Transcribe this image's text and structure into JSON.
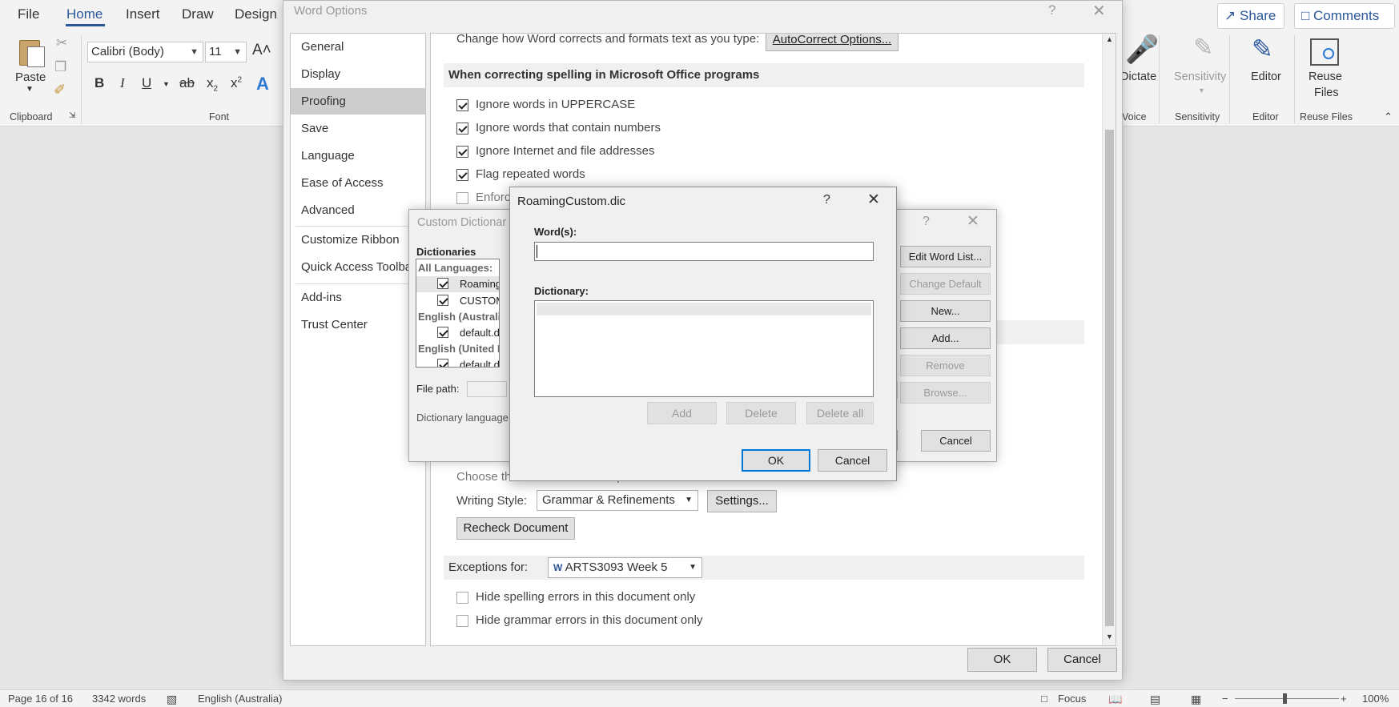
{
  "ribbon": {
    "tabs": [
      "File",
      "Home",
      "Insert",
      "Draw",
      "Design"
    ],
    "share_label": "Share",
    "comments_label": "Comments",
    "paste_label": "Paste",
    "font_name": "Calibri (Body)",
    "font_size": "11",
    "groups": {
      "clipboard": "Clipboard",
      "font": "Font",
      "voice": "Voice",
      "sensitivity": "Sensitivity",
      "editor": "Editor",
      "reuse_files": "Reuse Files"
    },
    "dictate_label": "Dictate",
    "sensitivity_label": "Sensitivity",
    "editor_label": "Editor",
    "reuse_files_label_1": "Reuse",
    "reuse_files_label_2": "Files"
  },
  "status_bar": {
    "page": "Page 16 of 16",
    "words": "3342 words",
    "language": "English (Australia)",
    "focus": "Focus",
    "zoom": "100%"
  },
  "word_options": {
    "title": "Word Options",
    "nav": [
      "General",
      "Display",
      "Proofing",
      "Save",
      "Language",
      "Ease of Access",
      "Advanced",
      "Customize Ribbon",
      "Quick Access Toolbar",
      "Add-ins",
      "Trust Center"
    ],
    "selected_nav": "Proofing",
    "autocorrect_text": "Change how Word corrects and formats text as you type:",
    "autocorrect_button": "AutoCorrect Options...",
    "spelling_section": "When correcting spelling in Microsoft Office programs",
    "options": [
      {
        "label": "Ignore words in UPPERCASE",
        "checked": true
      },
      {
        "label": "Ignore words that contain numbers",
        "checked": true
      },
      {
        "label": "Ignore Internet and file addresses",
        "checked": true
      },
      {
        "label": "Flag repeated words",
        "checked": true
      },
      {
        "label": "Enforc",
        "checked": false
      }
    ],
    "choose_text": "Choose the checks Editor will perform for Grammar and Refinements",
    "writing_style_label": "Writing Style:",
    "writing_style_value": "Grammar & Refinements",
    "settings_button": "Settings...",
    "recheck_button": "Recheck Document",
    "exceptions_label": "Exceptions for:",
    "exceptions_doc": "ARTS3093 Week 5",
    "exceptions": [
      {
        "label": "Hide spelling errors in this document only",
        "checked": false
      },
      {
        "label": "Hide grammar errors in this document only",
        "checked": false
      }
    ],
    "ok": "OK",
    "cancel": "Cancel"
  },
  "custom_dictionaries": {
    "title": "Custom Dictionar",
    "dictionaries_label": "Dictionaries",
    "groups": [
      {
        "header": "All Languages:",
        "items": [
          {
            "name": "RoamingC",
            "checked": true
          },
          {
            "name": "CUSTOM.D",
            "checked": true
          }
        ]
      },
      {
        "header": "English (Australia)",
        "items": [
          {
            "name": "default.dic",
            "checked": true
          }
        ]
      },
      {
        "header": "English (United Kin",
        "items": [
          {
            "name": "default.dic",
            "checked": true
          }
        ]
      }
    ],
    "file_path_label": "File path:",
    "dictionary_language_label": "Dictionary language",
    "buttons": {
      "edit_word_list": "Edit Word List...",
      "change_default": "Change Default",
      "new": "New...",
      "add": "Add...",
      "remove": "Remove",
      "browse": "Browse...",
      "cancel": "Cancel"
    }
  },
  "roaming_dialog": {
    "title": "RoamingCustom.dic",
    "words_label": "Word(s):",
    "words_value": "",
    "dictionary_label": "Dictionary:",
    "add": "Add",
    "delete": "Delete",
    "delete_all": "Delete all",
    "ok": "OK",
    "cancel": "Cancel"
  },
  "colors": {
    "accent": "#2b579a",
    "focus_blue": "#0078d7",
    "dialog_bg": "#f0f0f0"
  }
}
